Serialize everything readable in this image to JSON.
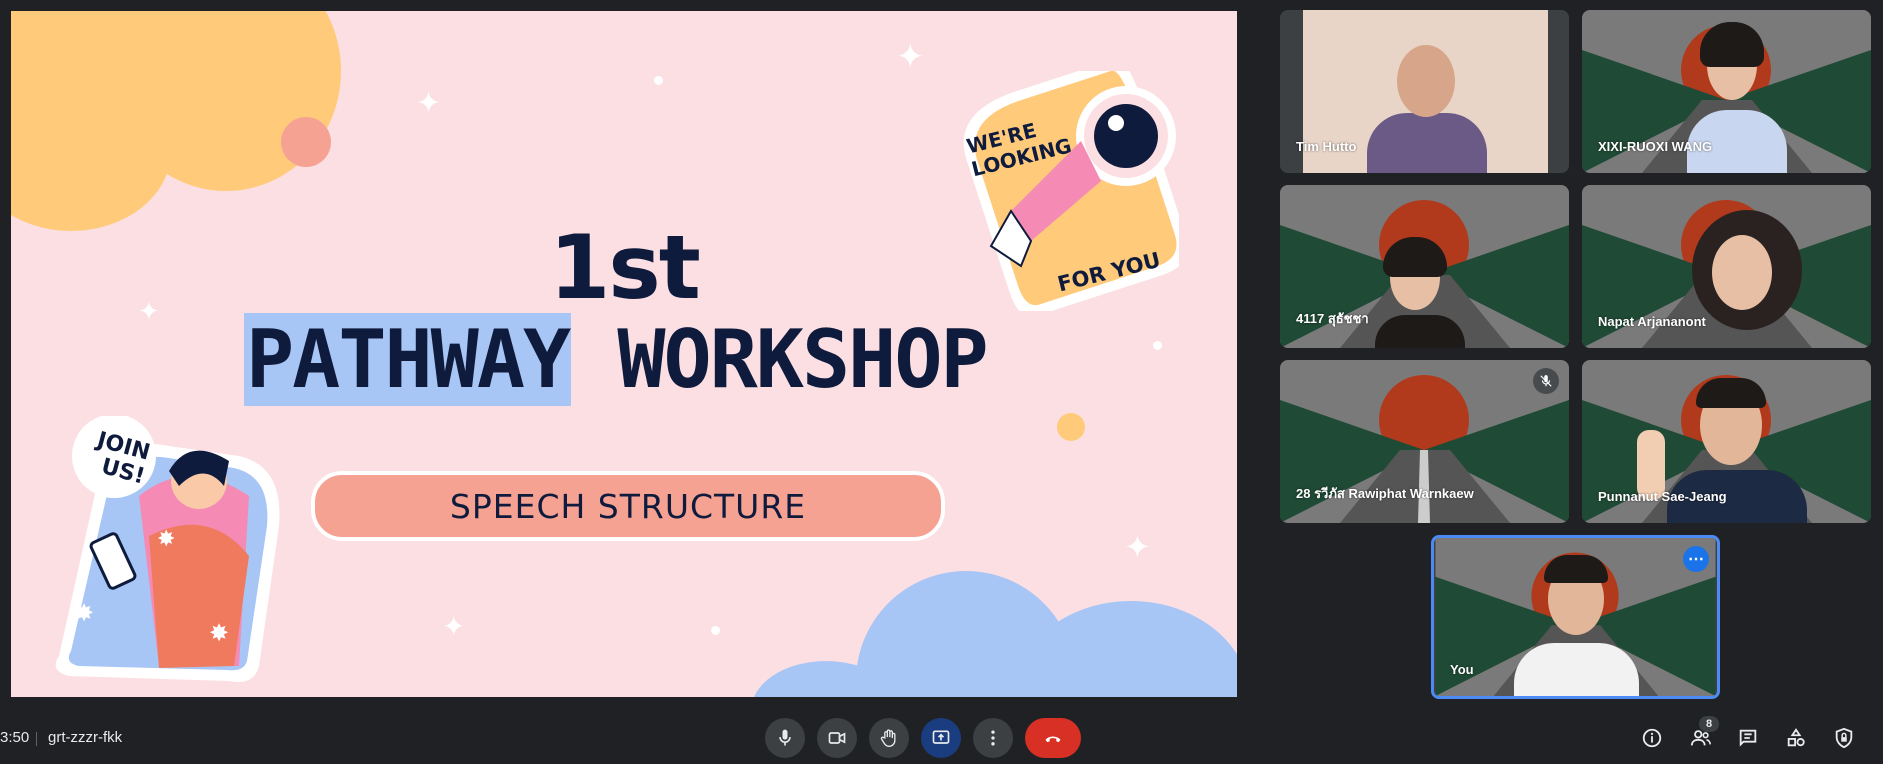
{
  "meeting": {
    "time": "3:50",
    "code": "grt-zzzr-fkk"
  },
  "slide": {
    "title_line1": "1st",
    "title_word1": "PATHWAY",
    "title_word2": "WORKSHOP",
    "subtitle": "SPEECH STRUCTURE",
    "sticker_right_top": "WE'RE\nLOOKING",
    "sticker_right_bottom": "FOR YOU",
    "sticker_left": "JOIN\nUS!",
    "colors": {
      "background": "#fbdfe2",
      "ink": "#0f1b3d",
      "highlight": "#a8c6f5",
      "pill": "#f6a292"
    }
  },
  "participants": [
    {
      "name": "Tim Hutto",
      "muted": false
    },
    {
      "name": "XIXI-RUOXI WANG",
      "muted": false
    },
    {
      "name": "4117 สุธัชชา",
      "muted": false
    },
    {
      "name": "Napat Arjananont",
      "muted": false
    },
    {
      "name": "28 รวีภัส Rawiphat Warnkaew",
      "muted": true
    },
    {
      "name": "Punnanut Sae-Jeang",
      "muted": false
    },
    {
      "name": "You",
      "muted": false
    }
  ],
  "controls": {
    "left": [
      {
        "icon": "microphone-icon"
      },
      {
        "icon": "camera-icon"
      },
      {
        "icon": "raise-hand-icon"
      },
      {
        "icon": "present-screen-icon"
      },
      {
        "icon": "more-options-icon"
      },
      {
        "icon": "end-call-icon"
      }
    ],
    "right": [
      {
        "icon": "info-icon"
      },
      {
        "icon": "people-icon",
        "badge": "8"
      },
      {
        "icon": "chat-icon"
      },
      {
        "icon": "activities-icon"
      },
      {
        "icon": "host-controls-icon"
      }
    ]
  }
}
